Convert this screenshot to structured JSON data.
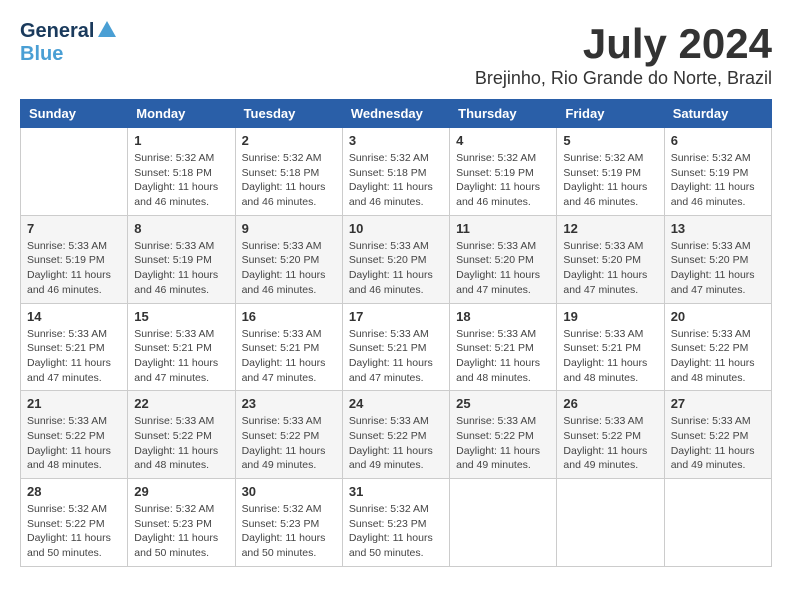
{
  "header": {
    "logo_general": "General",
    "logo_blue": "Blue",
    "month_title": "July 2024",
    "location": "Brejinho, Rio Grande do Norte, Brazil"
  },
  "weekdays": [
    "Sunday",
    "Monday",
    "Tuesday",
    "Wednesday",
    "Thursday",
    "Friday",
    "Saturday"
  ],
  "weeks": [
    [
      {
        "day": "",
        "info": ""
      },
      {
        "day": "1",
        "info": "Sunrise: 5:32 AM\nSunset: 5:18 PM\nDaylight: 11 hours\nand 46 minutes."
      },
      {
        "day": "2",
        "info": "Sunrise: 5:32 AM\nSunset: 5:18 PM\nDaylight: 11 hours\nand 46 minutes."
      },
      {
        "day": "3",
        "info": "Sunrise: 5:32 AM\nSunset: 5:18 PM\nDaylight: 11 hours\nand 46 minutes."
      },
      {
        "day": "4",
        "info": "Sunrise: 5:32 AM\nSunset: 5:19 PM\nDaylight: 11 hours\nand 46 minutes."
      },
      {
        "day": "5",
        "info": "Sunrise: 5:32 AM\nSunset: 5:19 PM\nDaylight: 11 hours\nand 46 minutes."
      },
      {
        "day": "6",
        "info": "Sunrise: 5:32 AM\nSunset: 5:19 PM\nDaylight: 11 hours\nand 46 minutes."
      }
    ],
    [
      {
        "day": "7",
        "info": "Sunrise: 5:33 AM\nSunset: 5:19 PM\nDaylight: 11 hours\nand 46 minutes."
      },
      {
        "day": "8",
        "info": "Sunrise: 5:33 AM\nSunset: 5:19 PM\nDaylight: 11 hours\nand 46 minutes."
      },
      {
        "day": "9",
        "info": "Sunrise: 5:33 AM\nSunset: 5:20 PM\nDaylight: 11 hours\nand 46 minutes."
      },
      {
        "day": "10",
        "info": "Sunrise: 5:33 AM\nSunset: 5:20 PM\nDaylight: 11 hours\nand 46 minutes."
      },
      {
        "day": "11",
        "info": "Sunrise: 5:33 AM\nSunset: 5:20 PM\nDaylight: 11 hours\nand 47 minutes."
      },
      {
        "day": "12",
        "info": "Sunrise: 5:33 AM\nSunset: 5:20 PM\nDaylight: 11 hours\nand 47 minutes."
      },
      {
        "day": "13",
        "info": "Sunrise: 5:33 AM\nSunset: 5:20 PM\nDaylight: 11 hours\nand 47 minutes."
      }
    ],
    [
      {
        "day": "14",
        "info": "Sunrise: 5:33 AM\nSunset: 5:21 PM\nDaylight: 11 hours\nand 47 minutes."
      },
      {
        "day": "15",
        "info": "Sunrise: 5:33 AM\nSunset: 5:21 PM\nDaylight: 11 hours\nand 47 minutes."
      },
      {
        "day": "16",
        "info": "Sunrise: 5:33 AM\nSunset: 5:21 PM\nDaylight: 11 hours\nand 47 minutes."
      },
      {
        "day": "17",
        "info": "Sunrise: 5:33 AM\nSunset: 5:21 PM\nDaylight: 11 hours\nand 47 minutes."
      },
      {
        "day": "18",
        "info": "Sunrise: 5:33 AM\nSunset: 5:21 PM\nDaylight: 11 hours\nand 48 minutes."
      },
      {
        "day": "19",
        "info": "Sunrise: 5:33 AM\nSunset: 5:21 PM\nDaylight: 11 hours\nand 48 minutes."
      },
      {
        "day": "20",
        "info": "Sunrise: 5:33 AM\nSunset: 5:22 PM\nDaylight: 11 hours\nand 48 minutes."
      }
    ],
    [
      {
        "day": "21",
        "info": "Sunrise: 5:33 AM\nSunset: 5:22 PM\nDaylight: 11 hours\nand 48 minutes."
      },
      {
        "day": "22",
        "info": "Sunrise: 5:33 AM\nSunset: 5:22 PM\nDaylight: 11 hours\nand 48 minutes."
      },
      {
        "day": "23",
        "info": "Sunrise: 5:33 AM\nSunset: 5:22 PM\nDaylight: 11 hours\nand 49 minutes."
      },
      {
        "day": "24",
        "info": "Sunrise: 5:33 AM\nSunset: 5:22 PM\nDaylight: 11 hours\nand 49 minutes."
      },
      {
        "day": "25",
        "info": "Sunrise: 5:33 AM\nSunset: 5:22 PM\nDaylight: 11 hours\nand 49 minutes."
      },
      {
        "day": "26",
        "info": "Sunrise: 5:33 AM\nSunset: 5:22 PM\nDaylight: 11 hours\nand 49 minutes."
      },
      {
        "day": "27",
        "info": "Sunrise: 5:33 AM\nSunset: 5:22 PM\nDaylight: 11 hours\nand 49 minutes."
      }
    ],
    [
      {
        "day": "28",
        "info": "Sunrise: 5:32 AM\nSunset: 5:22 PM\nDaylight: 11 hours\nand 50 minutes."
      },
      {
        "day": "29",
        "info": "Sunrise: 5:32 AM\nSunset: 5:23 PM\nDaylight: 11 hours\nand 50 minutes."
      },
      {
        "day": "30",
        "info": "Sunrise: 5:32 AM\nSunset: 5:23 PM\nDaylight: 11 hours\nand 50 minutes."
      },
      {
        "day": "31",
        "info": "Sunrise: 5:32 AM\nSunset: 5:23 PM\nDaylight: 11 hours\nand 50 minutes."
      },
      {
        "day": "",
        "info": ""
      },
      {
        "day": "",
        "info": ""
      },
      {
        "day": "",
        "info": ""
      }
    ]
  ]
}
